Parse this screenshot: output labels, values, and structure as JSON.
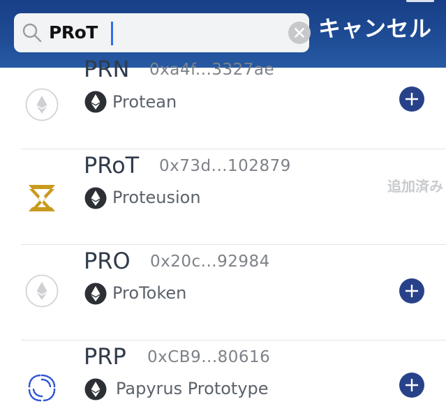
{
  "search": {
    "query": "PRoT",
    "cancel_label": "キャンセル"
  },
  "tokens": [
    {
      "symbol": "PRN",
      "address": "0xa4f...3327ae",
      "name": "Protean",
      "status": "add",
      "icon": "ethereum-placeholder-icon"
    },
    {
      "symbol": "PRoT",
      "address": "0x73d...102879",
      "name": "Proteusion",
      "status": "added",
      "status_label": "追加済み",
      "icon": "proteusion-logo-icon"
    },
    {
      "symbol": "PRO",
      "address": "0x20c...92984",
      "name": "ProToken",
      "status": "add",
      "icon": "ethereum-placeholder-icon"
    },
    {
      "symbol": "PRP",
      "address": "0xCB9...80616",
      "name": "Papyrus Prototype",
      "status": "add",
      "icon": "papyrus-logo-icon"
    }
  ],
  "colors": {
    "header": "#1e4c95",
    "add_button": "#28428a",
    "added_text": "#c8cace",
    "proteusion_gold": "#c99a1e"
  }
}
